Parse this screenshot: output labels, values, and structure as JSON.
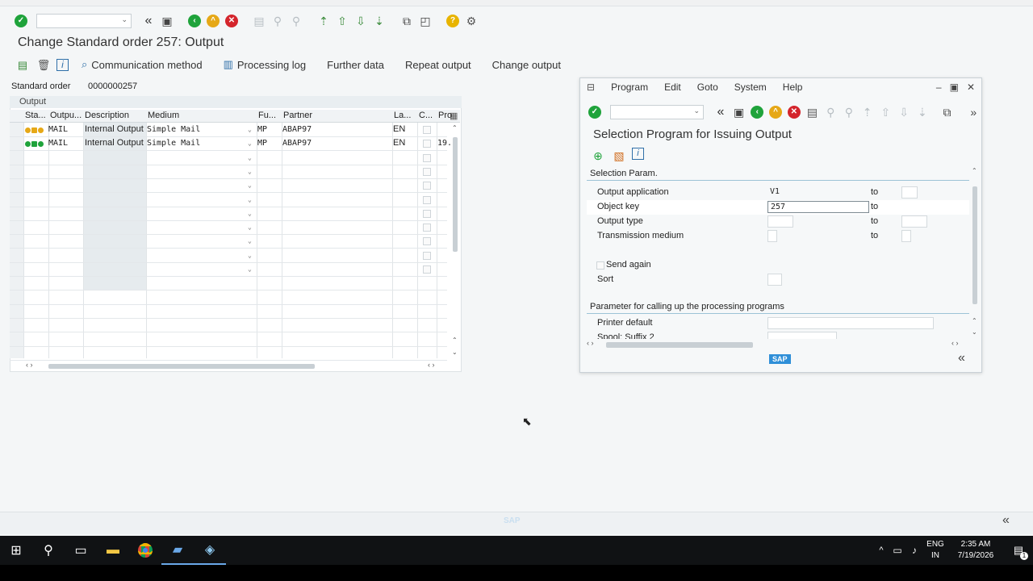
{
  "toolbar": {
    "icons": [
      "enter-icon",
      "command-field",
      "back-icon",
      "save-icon",
      "green-back-icon",
      "exit-icon",
      "cancel-icon",
      "print-icon",
      "find-icon",
      "find-next-icon",
      "first-page-icon",
      "prev-page-icon",
      "next-page-icon",
      "last-page-icon",
      "new-session-icon",
      "shortcut-icon",
      "help-icon",
      "settings-icon"
    ]
  },
  "screen": {
    "title": "Change Standard order 257: Output"
  },
  "app_toolbar": {
    "communication_method": "Communication method",
    "processing_log": "Processing log",
    "further_data": "Further data",
    "repeat_output": "Repeat output",
    "change_output": "Change output"
  },
  "header": {
    "order_label": "Standard order",
    "order_value": "0000000257"
  },
  "output_table": {
    "section_label": "Output",
    "columns": [
      "Sta...",
      "Outpu...",
      "Description",
      "Medium",
      "Fu...",
      "Partner",
      "La...",
      "C...",
      "Pro"
    ],
    "rows": [
      {
        "status_colors": [
          "#e6a817",
          "#e6a817",
          "#e6a817"
        ],
        "output": "MAIL",
        "description": "Internal Output",
        "medium": "Simple Mail",
        "function": "MP",
        "partner": "ABAP97",
        "language": "EN",
        "processed": ""
      },
      {
        "status_colors": [
          "#1fa33b",
          "#1fa33b",
          "#1fa33b"
        ],
        "output": "MAIL",
        "description": "Internal Output",
        "medium": "Simple Mail",
        "function": "MP",
        "partner": "ABAP97",
        "language": "EN",
        "processed": "19."
      }
    ]
  },
  "popup": {
    "menu": [
      "Program",
      "Edit",
      "Goto",
      "System",
      "Help"
    ],
    "title": "Selection Program for Issuing Output",
    "section1": "Selection Param.",
    "fields": [
      {
        "label": "Output application",
        "value": "V1",
        "to": "to"
      },
      {
        "label": "Object key",
        "value": "257",
        "to": "to"
      },
      {
        "label": "Output type",
        "value": "",
        "to": "to"
      },
      {
        "label": "Transmission medium",
        "value": "",
        "to": "to"
      }
    ],
    "send_again": "Send again",
    "sort": "Sort",
    "section2": "Parameter for calling up the processing programs",
    "printer_default": "Printer default",
    "spool_suffix": "Spool: Suffix 2",
    "logo": "SAP"
  },
  "taskbar": {
    "lang": "ENG",
    "region": "IN",
    "time": "2:35 AM",
    "date": "7/19/2026",
    "notif_count": "1"
  }
}
